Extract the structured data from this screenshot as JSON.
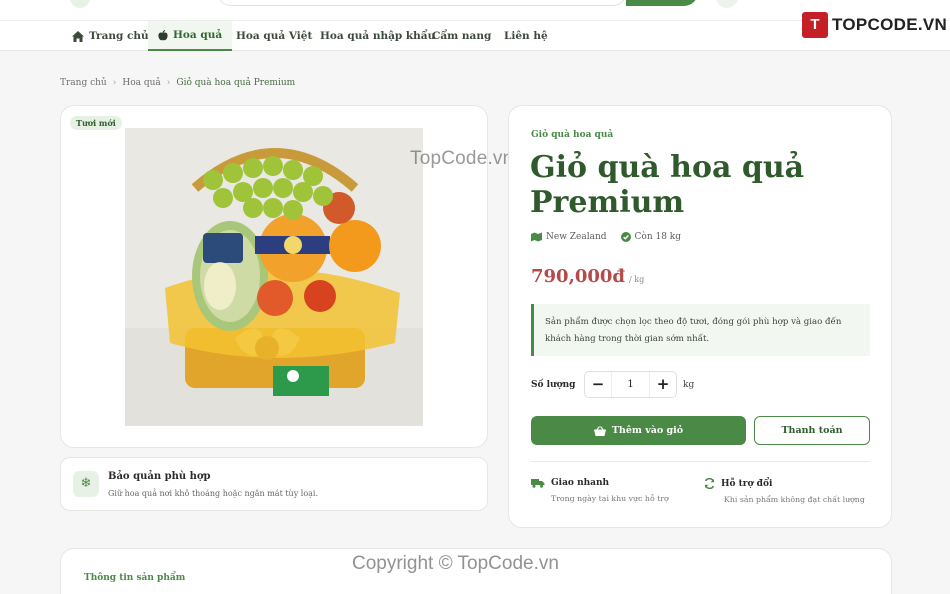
{
  "nav": {
    "items": [
      {
        "label": "Trang chủ",
        "icon": "home-icon"
      },
      {
        "label": "Hoa quả",
        "icon": "apple-icon",
        "active": true
      },
      {
        "label": "Hoa quả Việt"
      },
      {
        "label": "Hoa quả nhập khẩu"
      },
      {
        "label": "Cẩm nang"
      },
      {
        "label": "Liên hệ"
      }
    ]
  },
  "brand": {
    "badge": "T",
    "name": "TOPCODE.VN"
  },
  "breadcrumb": [
    "Trang chủ",
    "Hoa quả",
    "Giỏ quà hoa quả Premium"
  ],
  "gallery": {
    "badge": "Tươi mới",
    "image_alt": "Giỏ quà hoa quả Premium"
  },
  "watermarks": {
    "center": "TopCode.vn",
    "bottom": "Copyright © TopCode.vn"
  },
  "care": {
    "icon": "snowflake-icon",
    "title": "Bảo quản phù hợp",
    "text": "Giữ hoa quả nơi khô thoáng hoặc ngăn mát tùy loại."
  },
  "product": {
    "category": "Giỏ quà hoa quả",
    "title": "Giỏ quà hoa quả Premium",
    "origin": "New Zealand",
    "stock": "Còn 18 kg",
    "price": "790,000đ",
    "price_unit": "/ kg",
    "description": "Sản phẩm được chọn lọc theo độ tươi, đóng gói phù hợp và giao đến khách hàng trong thời gian sớm nhất."
  },
  "quantity": {
    "label": "Số lượng",
    "minus": "−",
    "value": "1",
    "plus": "+",
    "unit": "kg"
  },
  "actions": {
    "add_to_cart": "Thêm vào giỏ",
    "checkout": "Thanh toán"
  },
  "features": [
    {
      "icon": "truck-icon",
      "title": "Giao nhanh",
      "text": "Trong ngày tại khu vực hỗ trợ"
    },
    {
      "icon": "refresh-icon",
      "title": "Hỗ trợ đổi",
      "text": "Khi sản phẩm không đạt chất lượng"
    }
  ],
  "details": {
    "title": "Thông tin sản phẩm"
  },
  "colors": {
    "primary": "#4a8a46",
    "title": "#2e5a2c",
    "price": "#b44a4a",
    "brand_red": "#c42026"
  }
}
